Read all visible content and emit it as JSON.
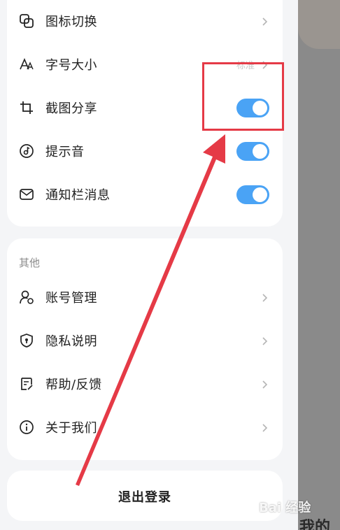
{
  "settings": {
    "items": [
      {
        "label": "图标切换",
        "control": "chevron"
      },
      {
        "label": "字号大小",
        "control": "value",
        "value": "标准"
      },
      {
        "label": "截图分享",
        "control": "toggle",
        "on": true
      },
      {
        "label": "提示音",
        "control": "toggle",
        "on": true
      },
      {
        "label": "通知栏消息",
        "control": "toggle",
        "on": true
      }
    ]
  },
  "other": {
    "title": "其他",
    "items": [
      {
        "label": "账号管理"
      },
      {
        "label": "隐私说明"
      },
      {
        "label": "帮助/反馈"
      },
      {
        "label": "关于我们"
      }
    ]
  },
  "logout": {
    "label": "退出登录"
  },
  "background_text": "我的",
  "watermark": "Bai 经验",
  "colors": {
    "toggle_on": "#4aa3f5",
    "annotation": "#e53a46"
  }
}
